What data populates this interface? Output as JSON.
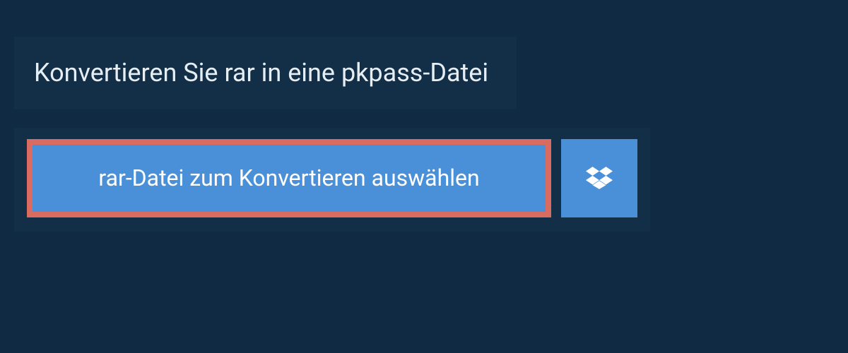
{
  "title": "Konvertieren Sie rar in eine pkpass-Datei",
  "actions": {
    "select_file_label": "rar-Datei zum Konvertieren auswählen",
    "dropbox_icon": "dropbox-icon"
  },
  "colors": {
    "background": "#0f2a42",
    "panel": "#132f47",
    "button": "#4a90d9",
    "highlight_border": "#d96b60",
    "text_light": "#e6eef4",
    "text_button": "#ffffff"
  }
}
